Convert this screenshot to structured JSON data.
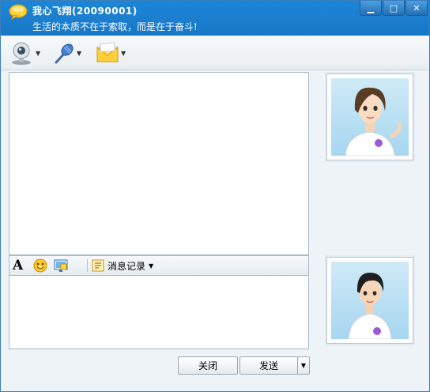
{
  "window": {
    "title": "我心飞翔(20090001)",
    "signature": "生活的本质不在于索取，而是在于奋斗!",
    "controls": {
      "minimize": "▁",
      "maximize": "□",
      "close": "✕"
    }
  },
  "toolbar": {
    "items": [
      {
        "icon": "webcam-icon"
      },
      {
        "icon": "microphone-icon"
      },
      {
        "icon": "mail-icon"
      }
    ]
  },
  "input_toolbar": {
    "font_icon_label": "A",
    "history_label": "消息记录"
  },
  "buttons": {
    "close_label": "关闭",
    "send_label": "发送"
  },
  "colors": {
    "titlebar": "#1a86d9",
    "window_bg": "#eef3f7"
  }
}
